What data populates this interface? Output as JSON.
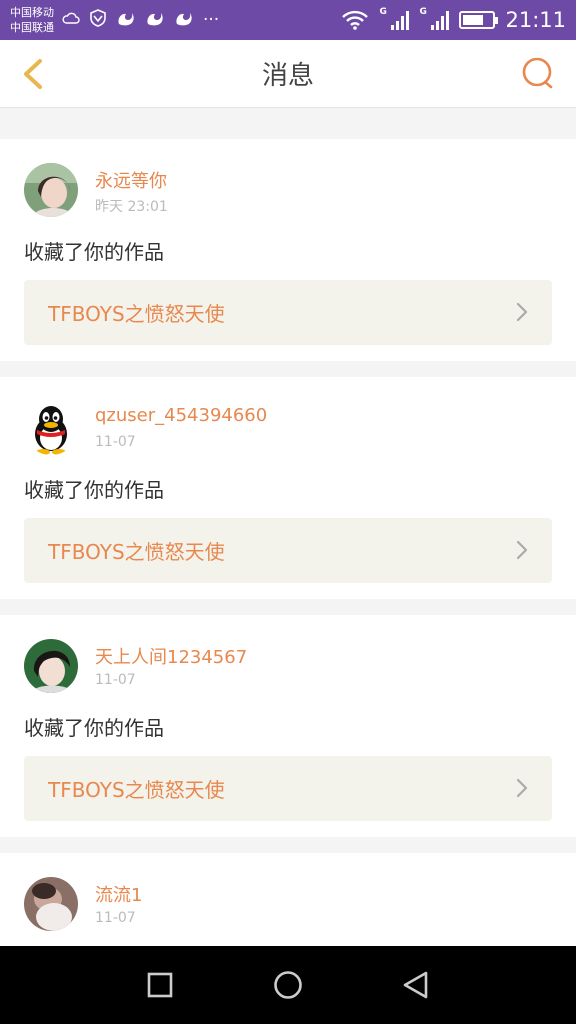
{
  "status_bar": {
    "carrier_1": "中国移动",
    "carrier_2": "中国联通",
    "signal_1_label": "G",
    "signal_2_label": "G",
    "time": "21:11",
    "more": "···",
    "icons": [
      "weather-cloud-icon",
      "shield-icon",
      "uc-browser-icon",
      "uc-browser-icon",
      "uc-browser-icon",
      "more-dots-icon",
      "wifi-icon",
      "signal-icon",
      "signal-icon",
      "battery-icon"
    ]
  },
  "header": {
    "title": "消息",
    "back_icon": "chevron-left-icon",
    "search_icon": "search-icon"
  },
  "messages": [
    {
      "username": "永远等你",
      "time": "昨天 23:01",
      "action": "收藏了你的作品",
      "work_title": "TFBOYS之愤怒天使"
    },
    {
      "username": "qzuser_454394660",
      "time": "11-07",
      "action": "收藏了你的作品",
      "work_title": "TFBOYS之愤怒天使"
    },
    {
      "username": "天上人间1234567",
      "time": "11-07",
      "action": "收藏了你的作品",
      "work_title": "TFBOYS之愤怒天使"
    },
    {
      "username": "流流1",
      "time": "11-07",
      "action": "",
      "work_title": ""
    }
  ],
  "system_nav": {
    "icons": [
      "recent-apps-icon",
      "home-icon",
      "back-icon"
    ]
  },
  "colors": {
    "status_bar": "#6e4aa7",
    "accent": "#e8884e",
    "header_icon": "#e8b84e",
    "link_background": "#f3f3ec",
    "separator": "#f4f4f4"
  }
}
